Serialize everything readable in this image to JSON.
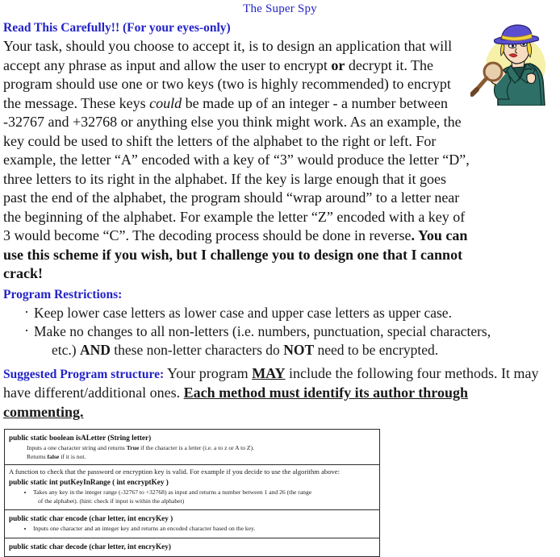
{
  "document": {
    "title": "The Super Spy",
    "heading": "Read This Carefully!! (For your eyes-only)",
    "intro": {
      "p1_a": "Your task, should you choose to accept it, is to design an application that will accept any phrase as input and allow the user to encrypt ",
      "p1_bold_or": "or",
      "p1_b": " decrypt it. The program should use one or two keys (two is highly recommended) to encrypt the message. These keys ",
      "p1_italic_could": "could",
      "p1_c": " be made up of an integer - a number between -32767 and +32768 or anything else you think might work. As an example, the key could be used to shift the letters of the alphabet to the right or left. For example, the letter “A” encoded with a key of “3” would produce the letter “D”, three letters to its right in the alphabet. If the key is large enough that it goes past the end of the alphabet, the program should “wrap around” to a letter near the beginning of the alphabet. For example the letter “Z” encoded with a key of 3 would become “C”. The decoding process should be done in reverse",
      "p1_bold_tail": ". You can use this scheme if you wish, but I challenge you to design one that I cannot crack!"
    },
    "restrictions": {
      "heading": "Program Restrictions:",
      "items": [
        "Keep lower case letters as lower case and upper case letters as upper case.",
        "Make no changes to all non-letters (i.e. numbers, punctuation, special characters,"
      ],
      "item2_cont_a": "etc.) ",
      "item2_cont_and": "AND",
      "item2_cont_b": " these non-letter characters do ",
      "item2_cont_not": "NOT",
      "item2_cont_c": " need to be encrypted."
    },
    "suggested": {
      "label": "Suggested Program structure:",
      "text_a": " Your program ",
      "may": "MAY",
      "text_b": " include the following four methods. It may have different/additional ones. ",
      "emphasis": "Each method must identify its author through commenting."
    },
    "methods_table": [
      {
        "signature": "public static boolean isALetter (String letter)",
        "lines": [
          {
            "a": "Inputs a one character string and returns ",
            "bold": "True",
            "b": " if the character is a letter (i.e. a to z or A to Z)."
          },
          {
            "a": "Returns ",
            "bold": "false",
            "b": " if it is not."
          }
        ]
      },
      {
        "preamble": "A function to check that the password or encryption key is valid. For example if you decide to use the algorithm above:",
        "signature": "public static int putKeyInRange ( int encryptKey )",
        "bullets": [
          {
            "main": "Takes any key in the integer range (-32767 to +32768) as input and returns a number between 1 and 26 (the range",
            "cont": "of the alphabet). (hint: check if input is within the alphabet)"
          }
        ]
      },
      {
        "signature": "public static char encode (char letter, int encryKey )",
        "bullets": [
          {
            "main": "Inputs one character and an integer key and returns an encoded character based on the key.",
            "cont": ""
          }
        ]
      },
      {
        "signature": "public static char decode (char letter, int encryKey)",
        "bullets": []
      }
    ],
    "illustration": {
      "name": "spy-detective-clipart",
      "colors": {
        "hat": "#5b4fd1",
        "hat_band": "#f2d23c",
        "coat": "#2e7068",
        "background_circle": "#f6f0a8",
        "skin": "#f7dcc0",
        "hair": "#f2d23c",
        "magnifier": "#8a5a32",
        "lips": "#c83030"
      }
    }
  },
  "theme": {
    "accent_blue": "#2323c8",
    "text": "#141414",
    "page_bg": "#ffffff",
    "table_border": "#2b2b2b"
  }
}
